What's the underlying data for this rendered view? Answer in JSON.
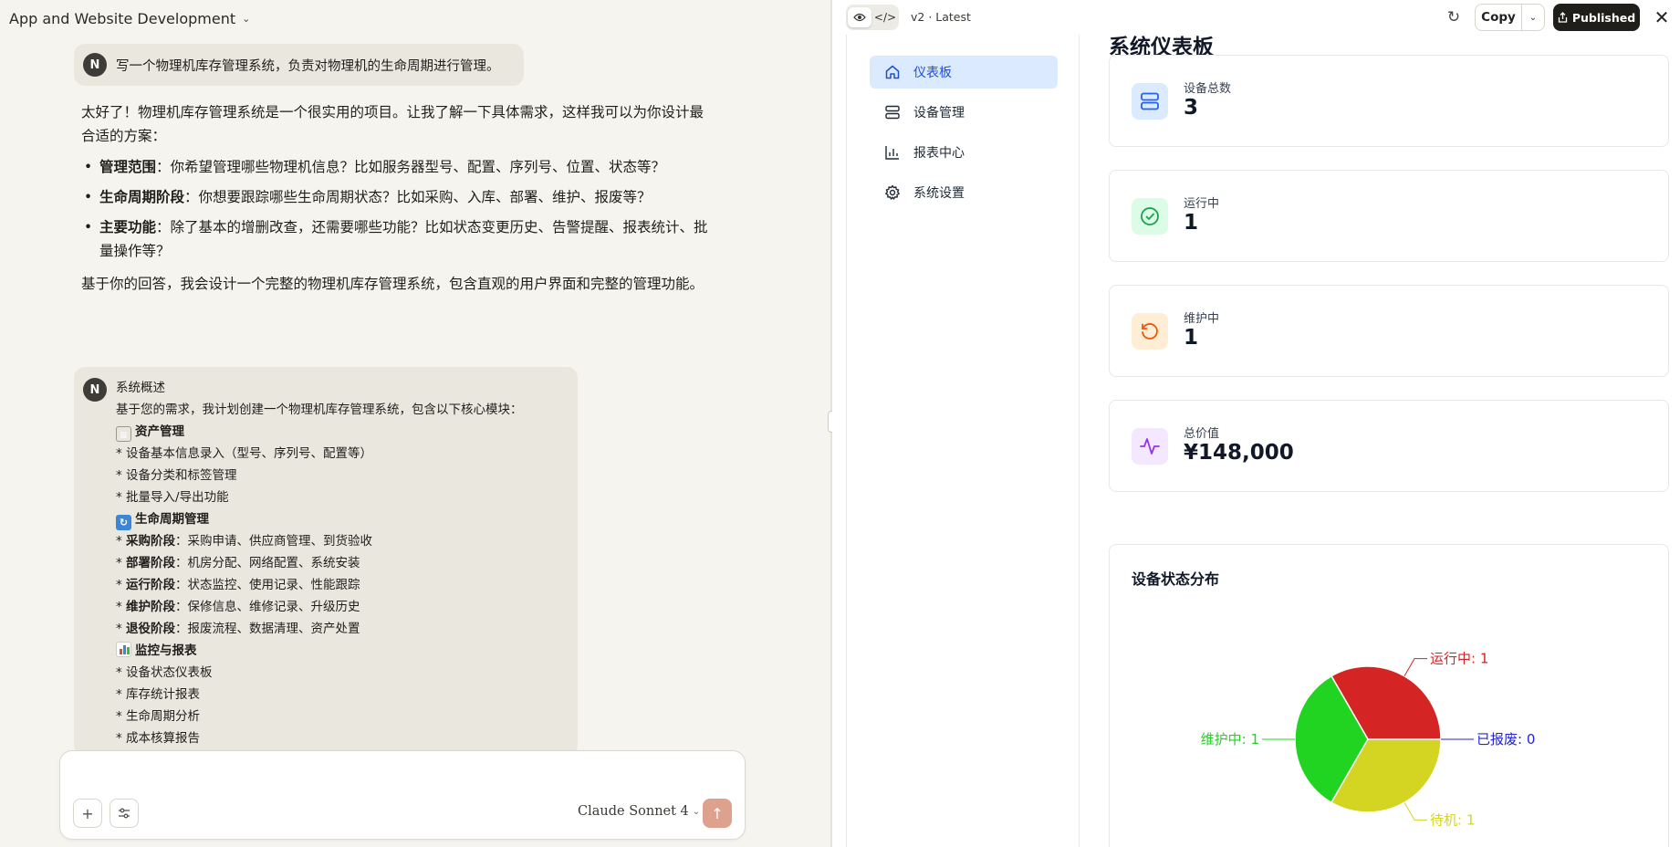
{
  "chat": {
    "project_title": "App and Website Development",
    "user_initial": "N",
    "message1": "写一个物理机库存管理系统，负责对物理机的生命周期进行管理。",
    "assistant": {
      "intro": "太好了！物理机库存管理系统是一个很实用的项目。让我了解一下具体需求，这样我可以为你设计最合适的方案：",
      "bullets": [
        {
          "title": "管理范围",
          "text": "：你希望管理哪些物理机信息？比如服务器型号、配置、序列号、位置、状态等？"
        },
        {
          "title": "生命周期阶段",
          "text": "：你想要跟踪哪些生命周期状态？比如采购、入库、部署、维护、报废等？"
        },
        {
          "title": "主要功能",
          "text": "：除了基本的增删改查，还需要哪些功能？比如状态变更历史、告警提醒、报表统计、批量操作等？"
        }
      ],
      "closing": "基于你的回答，我会设计一个完整的物理机库存管理系统，包含直观的用户界面和完整的管理功能。"
    },
    "message2": {
      "line1": "系统概述",
      "line2": "基于您的需求，我计划创建一个物理机库存管理系统，包含以下核心模块：",
      "sec1": "资产管理",
      "sec1_items": [
        "* 设备基本信息录入（型号、序列号、配置等）",
        "* 设备分类和标签管理",
        "* 批量导入/导出功能"
      ],
      "sec2": "生命周期管理",
      "sec2_items": [
        {
          "title": "采购阶段",
          "text": "：采购申请、供应商管理、到货验收"
        },
        {
          "title": "部署阶段",
          "text": "：机房分配、网络配置、系统安装"
        },
        {
          "title": "运行阶段",
          "text": "：状态监控、使用记录、性能跟踪"
        },
        {
          "title": "维护阶段",
          "text": "：保修信息、维修记录、升级历史"
        },
        {
          "title": "退役阶段",
          "text": "：报废流程、数据清理、资产处置"
        }
      ],
      "sec3": "监控与报表",
      "sec3_items": [
        "* 设备状态仪表板",
        "* 库存统计报表",
        "* 生命周期分析",
        "* 成本核算报告"
      ]
    },
    "composer": {
      "placeholder": "",
      "model": "Claude Sonnet 4"
    }
  },
  "artifact": {
    "version": "v2 · Latest",
    "copy_label": "Copy",
    "publish_label": "Published",
    "nav": [
      {
        "label": "仪表板",
        "icon": "home-icon",
        "active": true
      },
      {
        "label": "设备管理",
        "icon": "server-icon"
      },
      {
        "label": "报表中心",
        "icon": "bar-chart-icon"
      },
      {
        "label": "系统设置",
        "icon": "gear-icon"
      }
    ],
    "dashboard_title": "系统仪表板",
    "stats": [
      {
        "label": "设备总数",
        "value": "3",
        "icon": "server-icon",
        "color": "#2563eb",
        "bg": "#dbeafe"
      },
      {
        "label": "运行中",
        "value": "1",
        "icon": "check-circle-icon",
        "color": "#16a34a",
        "bg": "#dcfce7"
      },
      {
        "label": "维护中",
        "value": "1",
        "icon": "rotate-icon",
        "color": "#ea580c",
        "bg": "#ffedd5"
      },
      {
        "label": "总价值",
        "value": "¥148,000",
        "icon": "activity-icon",
        "color": "#9333ea",
        "bg": "#f3e8ff"
      }
    ],
    "chart_title": "设备状态分布"
  },
  "chart_data": {
    "type": "pie",
    "title": "设备状态分布",
    "slices": [
      {
        "label": "运行中",
        "value": 1,
        "color": "#d42424"
      },
      {
        "label": "维护中",
        "value": 1,
        "color": "#22d422"
      },
      {
        "label": "待机",
        "value": 1,
        "color": "#d4d422"
      },
      {
        "label": "已报废",
        "value": 0,
        "color": "#2424d4"
      }
    ],
    "labels_text": [
      "运行中: 1",
      "维护中: 1",
      "待机: 1",
      "已报废: 0"
    ]
  }
}
